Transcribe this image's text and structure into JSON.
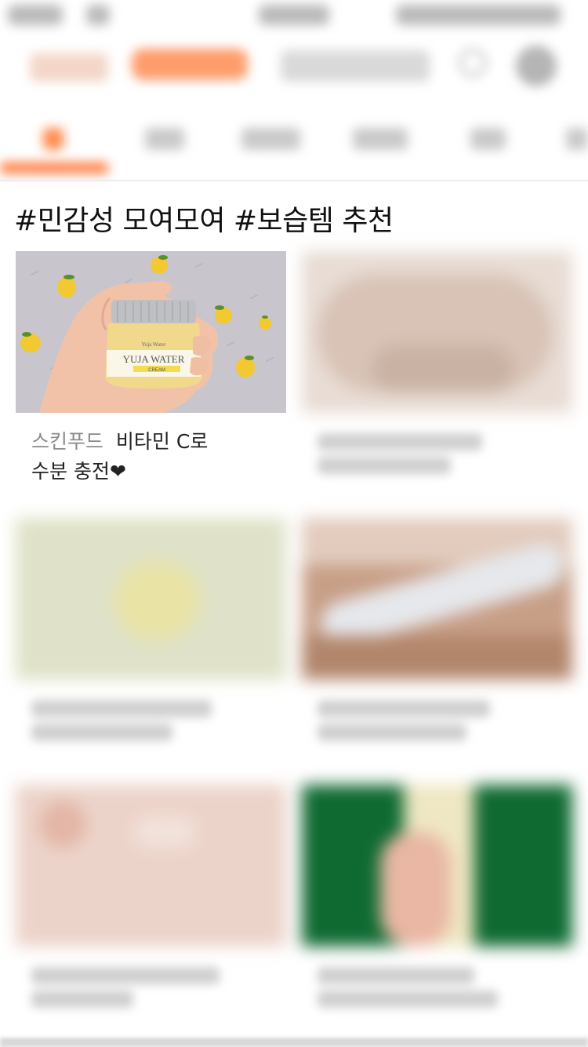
{
  "section": {
    "title": "#민감성 모여모여 #보습템 추천"
  },
  "featured": {
    "brand": "스킨푸드",
    "title_line1": "비타민 C로",
    "title_line2": "수분 충전❤",
    "product_label_top": "Yuja Water",
    "product_label_main": "YUJA WATER",
    "product_label_sub": "CREAM"
  },
  "colors": {
    "accent": "#ff7a3d",
    "background": "#ffffff",
    "text": "#111111",
    "brand_text": "#8a8a8a"
  }
}
